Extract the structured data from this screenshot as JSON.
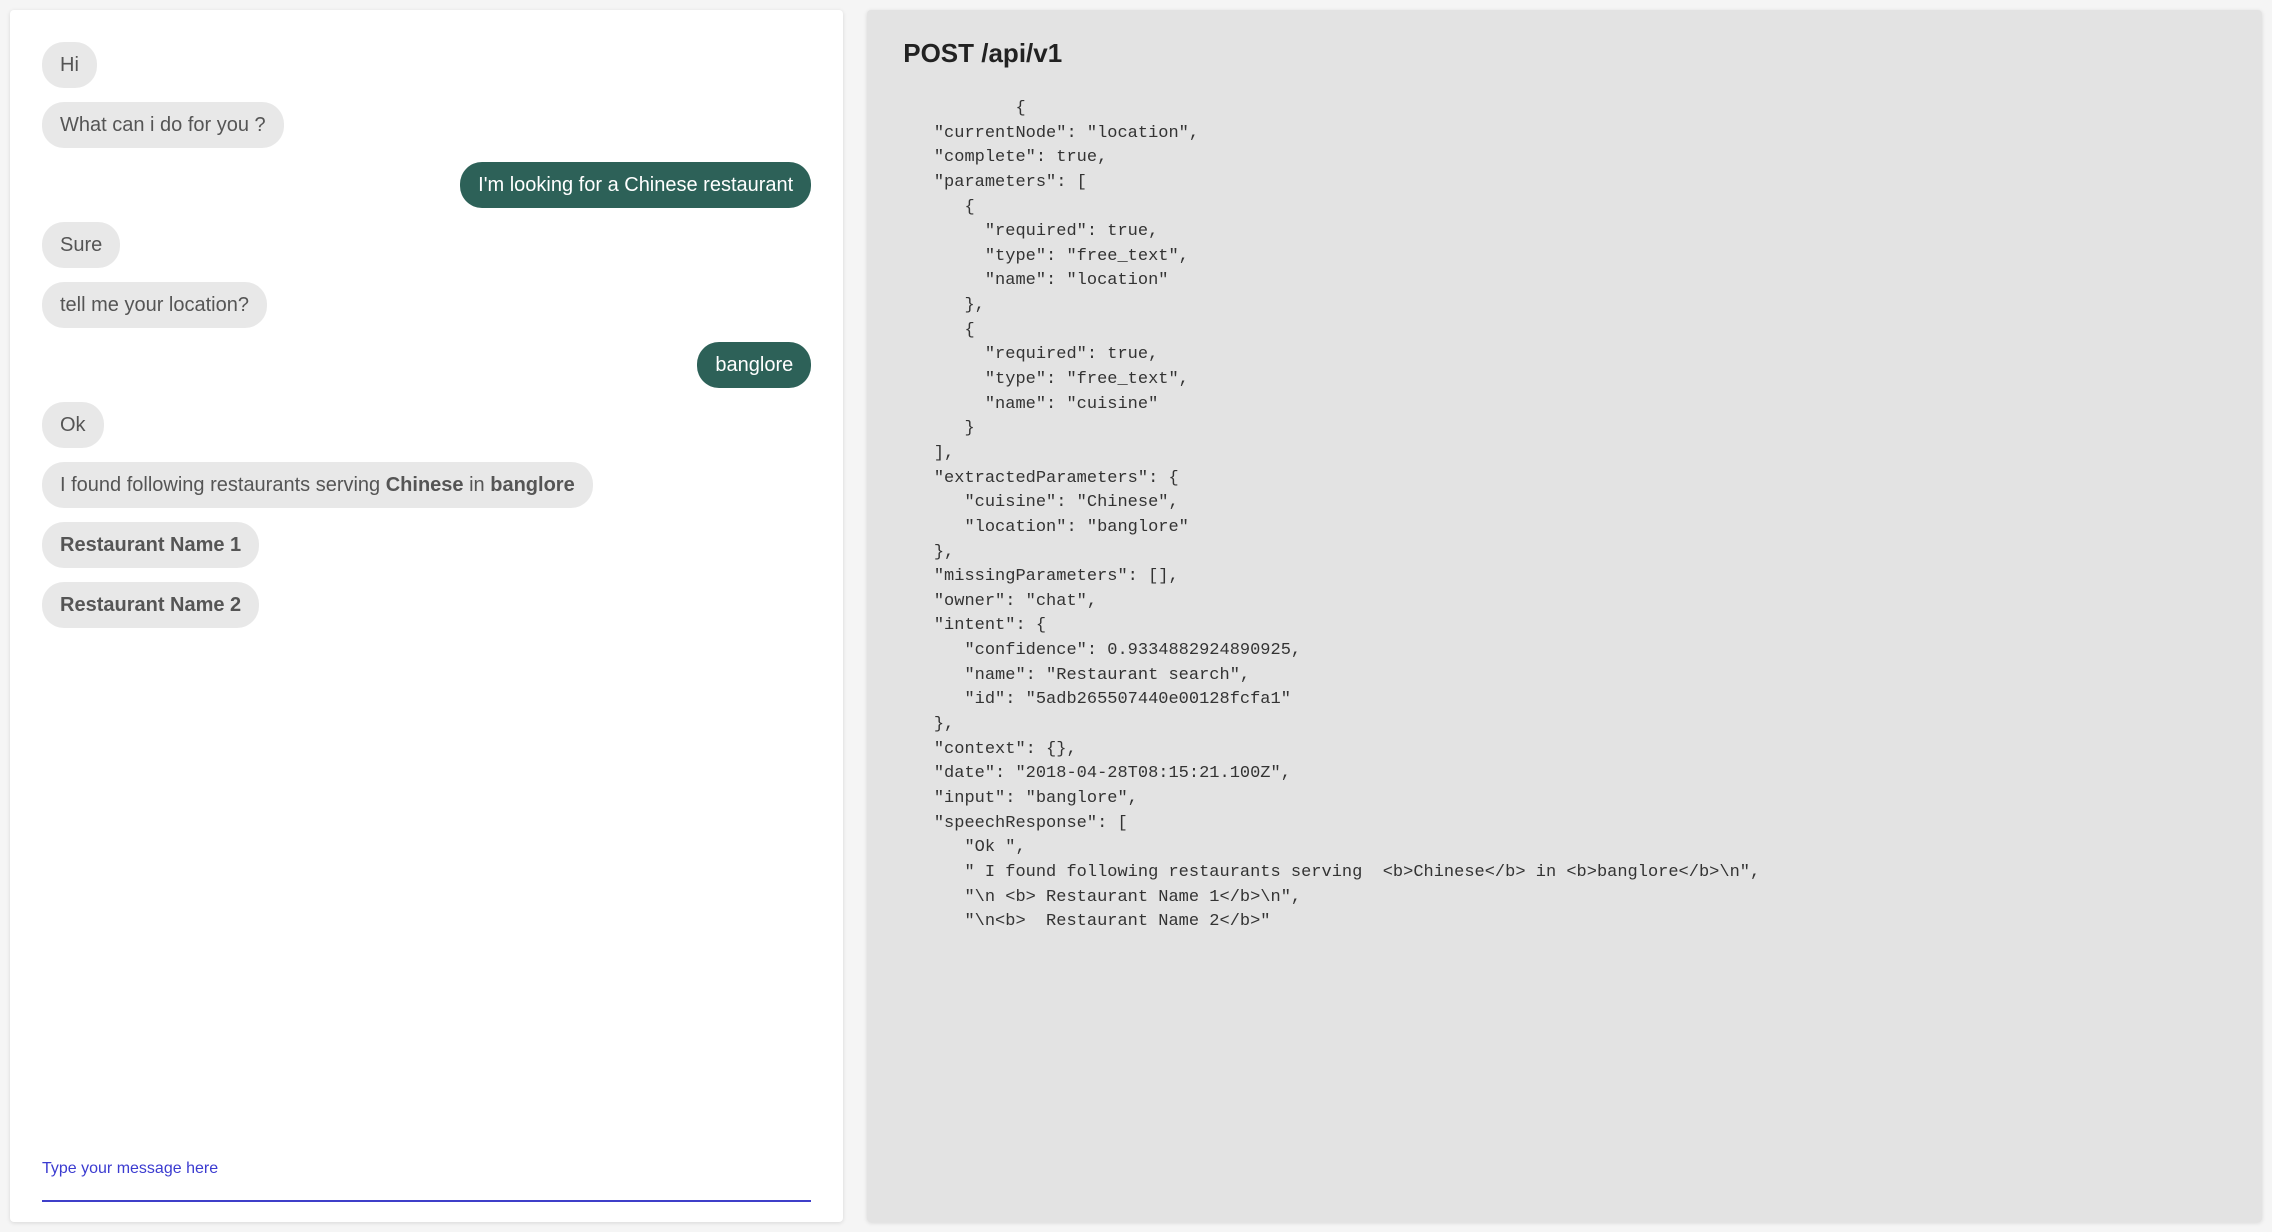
{
  "chat": {
    "messages": [
      {
        "side": "bot",
        "text": "Hi"
      },
      {
        "side": "bot",
        "text": "What can i do for you ?"
      },
      {
        "side": "user",
        "text": "I'm looking for a Chinese restaurant"
      },
      {
        "side": "bot",
        "text": "Sure"
      },
      {
        "side": "bot",
        "text": "tell me your location?"
      },
      {
        "side": "user",
        "text": "banglore"
      },
      {
        "side": "bot",
        "text": "Ok"
      },
      {
        "side": "bot",
        "html": "I found following restaurants serving <b>Chinese</b> in <b>banglore</b>"
      },
      {
        "side": "bot",
        "text": "Restaurant Name 1",
        "bold": true
      },
      {
        "side": "bot",
        "text": "Restaurant Name 2",
        "bold": true
      }
    ],
    "input_placeholder": "Type your message here"
  },
  "api": {
    "title": "POST /api/v1",
    "body": "           {\n   \"currentNode\": \"location\",\n   \"complete\": true,\n   \"parameters\": [\n      {\n        \"required\": true,\n        \"type\": \"free_text\",\n        \"name\": \"location\"\n      },\n      {\n        \"required\": true,\n        \"type\": \"free_text\",\n        \"name\": \"cuisine\"\n      }\n   ],\n   \"extractedParameters\": {\n      \"cuisine\": \"Chinese\",\n      \"location\": \"banglore\"\n   },\n   \"missingParameters\": [],\n   \"owner\": \"chat\",\n   \"intent\": {\n      \"confidence\": 0.9334882924890925,\n      \"name\": \"Restaurant search\",\n      \"id\": \"5adb265507440e00128fcfa1\"\n   },\n   \"context\": {},\n   \"date\": \"2018-04-28T08:15:21.100Z\",\n   \"input\": \"banglore\",\n   \"speechResponse\": [\n      \"Ok \",\n      \" I found following restaurants serving  <b>Chinese</b> in <b>banglore</b>\\n\",\n      \"\\n <b> Restaurant Name 1</b>\\n\",\n      \"\\n<b>  Restaurant Name 2</b>\""
  }
}
